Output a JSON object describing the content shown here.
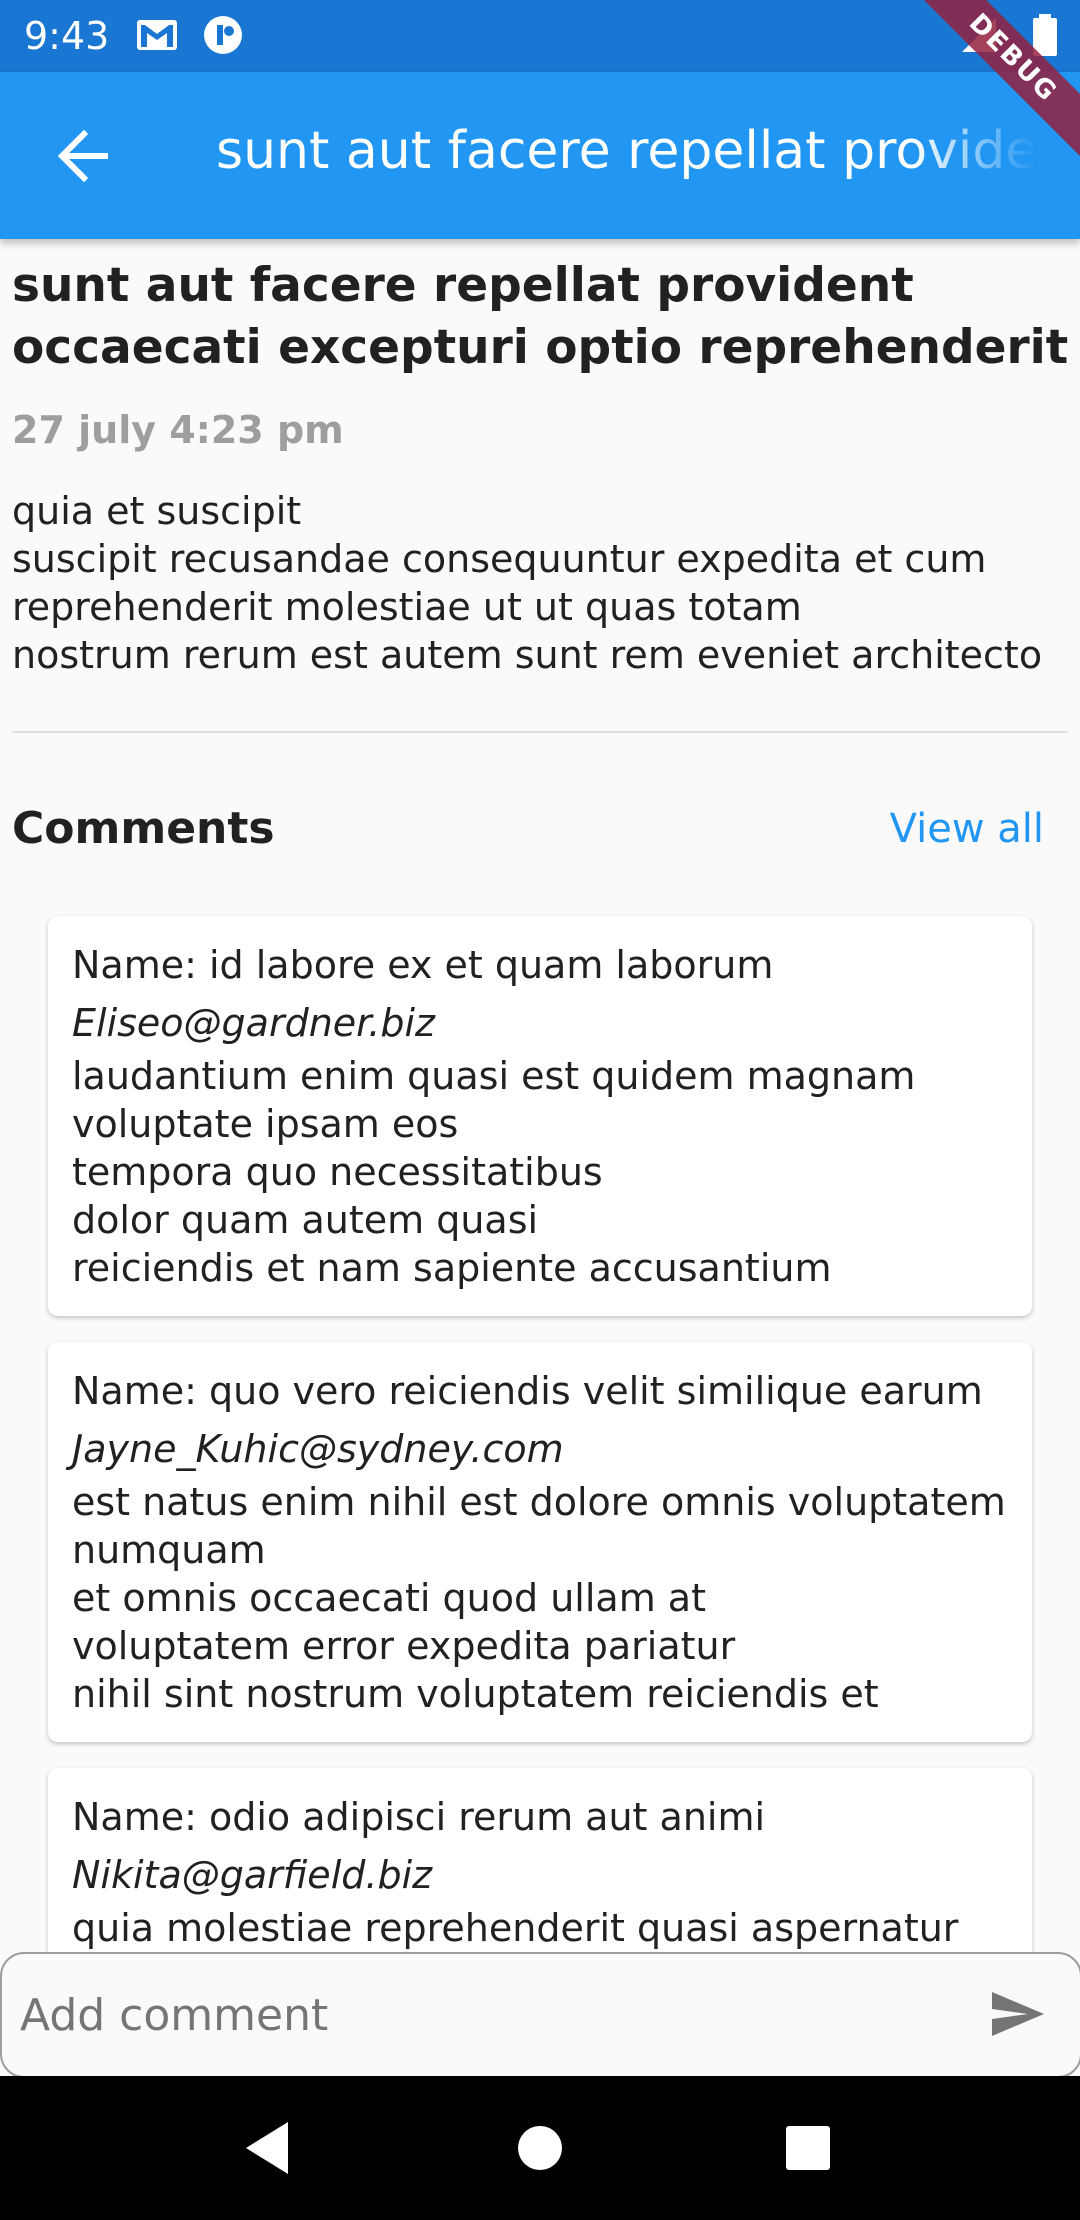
{
  "status_bar": {
    "time": "9:43",
    "icons": [
      "gmail-icon",
      "app-notification-icon",
      "signal-icon",
      "battery-icon"
    ]
  },
  "app_bar": {
    "title": "sunt aut facere repellat provident occaecati excepturi optio reprehenderit",
    "back_icon": "arrow-back-icon",
    "debug_label": "DEBUG",
    "color": "#2196f3"
  },
  "post": {
    "title": "sunt aut facere repellat provident occaecati excepturi optio reprehenderit",
    "date": "27 july 4:23 pm",
    "body": "quia et suscipit\nsuscipit recusandae consequuntur expedita et cum\nreprehenderit molestiae ut ut quas totam\nnostrum rerum est autem sunt rem eveniet architecto"
  },
  "comments": {
    "heading": "Comments",
    "view_all": "View all",
    "items": [
      {
        "name": "Name: id labore ex et quam laborum",
        "email": "Eliseo@gardner.biz",
        "body": "laudantium enim quasi est quidem magnam\nvoluptate ipsam eos\ntempora quo necessitatibus\ndolor quam autem quasi\nreiciendis et nam sapiente accusantium"
      },
      {
        "name": "Name: quo vero reiciendis velit similique earum",
        "email": "Jayne_Kuhic@sydney.com",
        "body": "est natus enim nihil est dolore omnis voluptatem\nnumquam\net omnis occaecati quod ullam at\nvoluptatem error expedita pariatur\nnihil sint nostrum voluptatem reiciendis et"
      },
      {
        "name": "Name: odio adipisci rerum aut animi",
        "email": "Nikita@garfield.biz",
        "body": "quia molestiae reprehenderit quasi aspernatur"
      }
    ]
  },
  "comment_input": {
    "placeholder": "Add comment",
    "send_icon": "send-icon"
  },
  "nav_bar": {
    "buttons": [
      "back-triangle-icon",
      "home-circle-icon",
      "recents-square-icon"
    ]
  }
}
